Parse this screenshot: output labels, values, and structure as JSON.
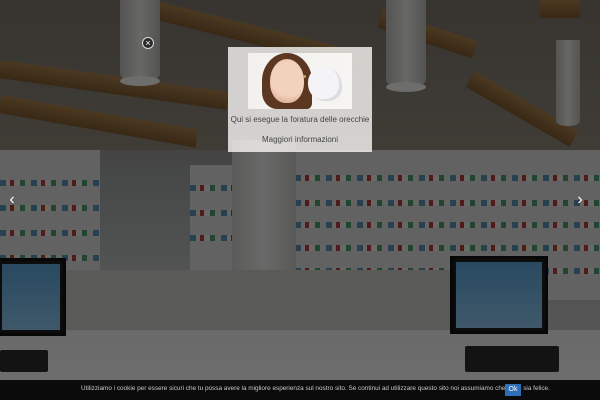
{
  "slider": {
    "prev_glyph": "‹",
    "next_glyph": "›",
    "prev_icon": "chevron-left-icon",
    "next_icon": "chevron-right-icon"
  },
  "popup": {
    "text": "Qui si esegue la foratura delle orecchie",
    "link_label": "Maggiori informazioni",
    "close_glyph": "×",
    "close_icon": "close-icon"
  },
  "cookie_bar": {
    "text": "Utilizziamo i cookie per essere sicuri che tu possa avere la migliore esperienza sul nostro sito. Se continui ad utilizzare questo sito noi assumiamo che tu ne sia felice.",
    "ok_label": "Ok"
  },
  "colors": {
    "cookie_bar_bg": "#0b0b0b",
    "ok_button_bg": "#2e6fb7",
    "popup_bg": "#f4f3f1"
  }
}
